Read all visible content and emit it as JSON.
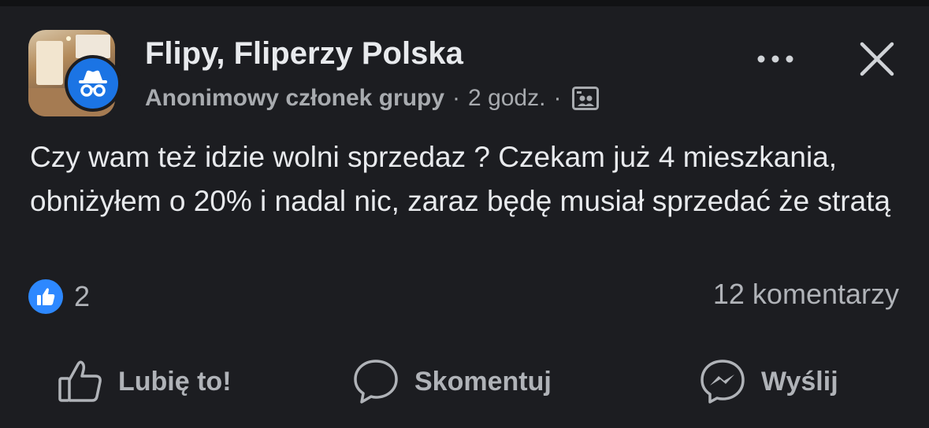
{
  "post": {
    "group_name": "Flipy, Fliperzy Polska",
    "author": "Anonimowy członek grupy",
    "separator": "·",
    "time": "2 godz.",
    "text": "Czy wam też idzie wolni sprzedaz ? Czekam już 4 mieszkania, obniżyłem o 20% i nadal nic, zaraz będę musiał sprzedać że stratą",
    "reaction_count": "2",
    "comments_count": "12 komentarzy"
  },
  "icons": {
    "more": "more-horizontal-icon",
    "close": "close-icon",
    "audience": "group-members-icon",
    "anon": "incognito-icon",
    "like_badge": "thumbs-up-icon",
    "like": "thumbs-up-outline-icon",
    "comment": "speech-bubble-icon",
    "send": "messenger-icon"
  },
  "actions": {
    "like_label": "Lubię to!",
    "comment_label": "Skomentuj",
    "send_label": "Wyślij"
  },
  "colors": {
    "background": "#1c1d21",
    "accent_blue": "#2d88ff",
    "text_primary": "#e8eaed",
    "text_secondary": "#b0b3b8"
  }
}
